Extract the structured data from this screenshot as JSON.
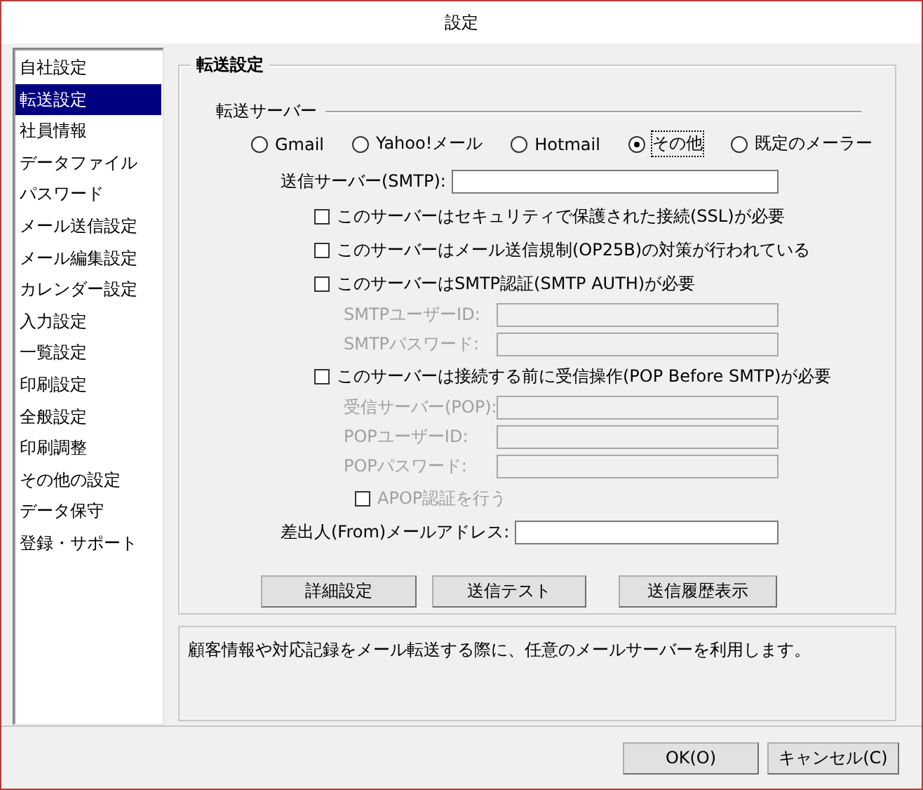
{
  "window": {
    "title": "設定"
  },
  "sidebar": {
    "items": [
      {
        "label": "自社設定",
        "selected": false
      },
      {
        "label": "転送設定",
        "selected": true
      },
      {
        "label": "社員情報",
        "selected": false
      },
      {
        "label": "データファイル",
        "selected": false
      },
      {
        "label": "パスワード",
        "selected": false
      },
      {
        "label": "メール送信設定",
        "selected": false
      },
      {
        "label": "メール編集設定",
        "selected": false
      },
      {
        "label": "カレンダー設定",
        "selected": false
      },
      {
        "label": "入力設定",
        "selected": false
      },
      {
        "label": "一覧設定",
        "selected": false
      },
      {
        "label": "印刷設定",
        "selected": false
      },
      {
        "label": "全般設定",
        "selected": false
      },
      {
        "label": "印刷調整",
        "selected": false
      },
      {
        "label": "その他の設定",
        "selected": false
      },
      {
        "label": "データ保守",
        "selected": false
      },
      {
        "label": "登録・サポート",
        "selected": false
      }
    ]
  },
  "section": {
    "title": "転送設定",
    "server_group": {
      "title": "転送サーバー",
      "options": [
        {
          "label": "Gmail",
          "selected": false
        },
        {
          "label": "Yahoo!メール",
          "selected": false
        },
        {
          "label": "Hotmail",
          "selected": false
        },
        {
          "label": "その他",
          "selected": true
        },
        {
          "label": "既定のメーラー",
          "selected": false
        }
      ]
    },
    "rows": [
      {
        "kind": "field",
        "label": "送信サーバー(SMTP):",
        "disabled": false
      },
      {
        "kind": "checkbox",
        "label": "このサーバーはセキュリティで保護された接続(SSL)が必要",
        "checked": false,
        "disabled": false
      },
      {
        "kind": "checkbox",
        "label": "このサーバーはメール送信規制(OP25B)の対策が行われている",
        "checked": false,
        "disabled": false
      },
      {
        "kind": "checkbox",
        "label": "このサーバーはSMTP認証(SMTP AUTH)が必要",
        "checked": false,
        "disabled": false,
        "children": [
          {
            "kind": "field",
            "label": "SMTPユーザーID:",
            "disabled": true
          },
          {
            "kind": "field",
            "label": "SMTPパスワード:",
            "disabled": true
          }
        ]
      },
      {
        "kind": "checkbox",
        "label": "このサーバーは接続する前に受信操作(POP Before SMTP)が必要",
        "checked": false,
        "disabled": false,
        "children": [
          {
            "kind": "field",
            "label": "受信サーバー(POP):",
            "disabled": true
          },
          {
            "kind": "field",
            "label": "POPユーザーID:",
            "disabled": true
          },
          {
            "kind": "field",
            "label": "POPパスワード:",
            "disabled": true
          },
          {
            "kind": "checkbox",
            "label": "APOP認証を行う",
            "checked": false,
            "disabled": true
          }
        ]
      },
      {
        "kind": "field",
        "label": "差出人(From)メールアドレス:",
        "disabled": false
      }
    ],
    "buttons": [
      "詳細設定",
      "送信テスト",
      "送信履歴表示"
    ]
  },
  "description": "顧客情報や対応記録をメール転送する際に、任意のメールサーバーを利用します。",
  "footer_buttons": [
    "OK(O)",
    "キャンセル(C)"
  ]
}
